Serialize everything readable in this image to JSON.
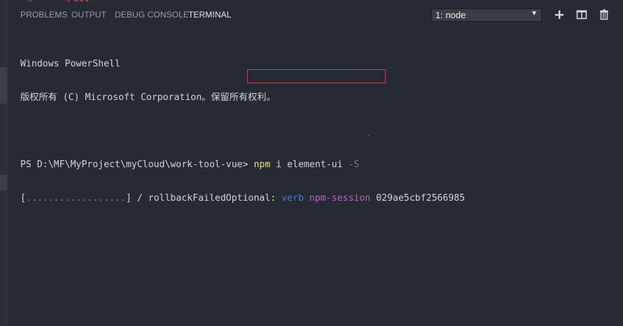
{
  "editor_peek": {
    "indent": "</",
    "text": "</div>"
  },
  "tabs": [
    {
      "label": "PROBLEMS",
      "active": false
    },
    {
      "label": "OUTPUT",
      "active": false
    },
    {
      "label": "DEBUG CONSOLE",
      "active": false
    },
    {
      "label": "TERMINAL",
      "active": true
    }
  ],
  "terminal_select": {
    "selected": "1: node",
    "arrow": "▼"
  },
  "toolbar": {
    "icons": [
      "plus-icon",
      "split-icon",
      "trash-icon"
    ]
  },
  "terminal": {
    "lines": {
      "l1": "Windows PowerShell",
      "l2": "版权所有 (C) Microsoft Corporation。保留所有权利。",
      "prompt": "PS D:\\MF\\MyProject\\myCloud\\work-tool-vue> ",
      "cmd_npm": "npm",
      "cmd_rest": " i element-ui ",
      "cmd_flag": "-S",
      "progress_open": "[",
      "progress_dots": "..................",
      "progress_close": "] / rollbackFailedOptional: ",
      "verb": "verb",
      "space": " ",
      "session": "npm-session",
      "session_id": " 029ae5cbf2566985"
    }
  },
  "colors": {
    "background": "#262a33",
    "highlight_box": "#e0343a",
    "command": "#f0e16c",
    "verb": "#3a82d8",
    "session": "#c45cc4"
  }
}
